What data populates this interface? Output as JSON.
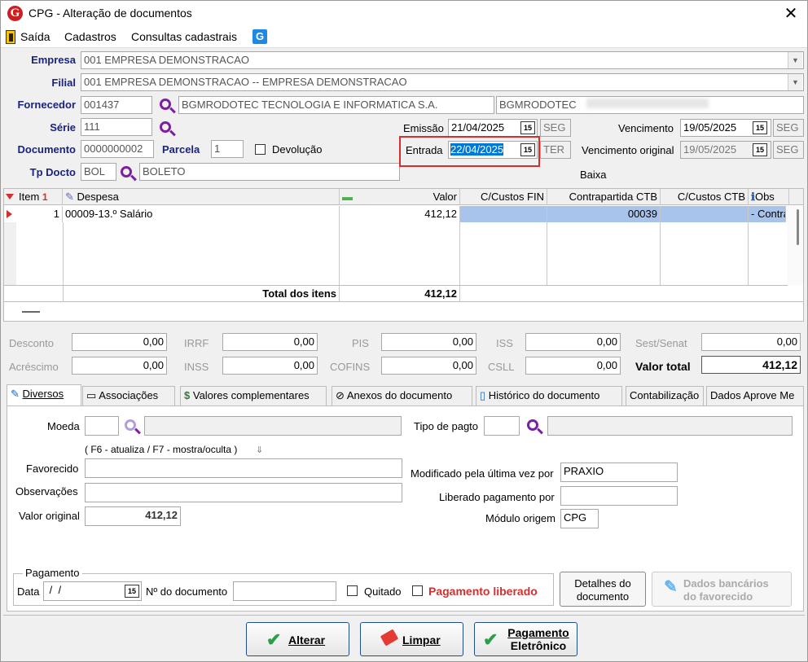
{
  "window": {
    "title": "CPG - Alteração de documentos",
    "logo_letter": "G"
  },
  "menu": {
    "items": [
      "Saída",
      "Cadastros",
      "Consultas cadastrais"
    ]
  },
  "header": {
    "empresa_label": "Empresa",
    "empresa_value": "001 EMPRESA DEMONSTRACAO",
    "filial_label": "Filial",
    "filial_value": "001 EMPRESA DEMONSTRACAO -- EMPRESA DEMONSTRACAO",
    "fornecedor_label": "Fornecedor",
    "fornecedor_code": "001437",
    "fornecedor_name": "BGMRODOTEC TECNOLOGIA E INFORMATICA S.A.",
    "fornecedor_short": "BGMRODOTEC",
    "serie_label": "Série",
    "serie_value": "111",
    "documento_label": "Documento",
    "documento_value": "0000000002",
    "parcela_label": "Parcela",
    "parcela_value": "1",
    "devolucao_label": "Devolução",
    "tpdocto_label": "Tp Docto",
    "tpdocto_code": "BOL",
    "tpdocto_name": "BOLETO",
    "emissao_label": "Emissão",
    "emissao_value": "21/04/2025",
    "emissao_day": "SEG",
    "entrada_label": "Entrada",
    "entrada_value": "22/04/2025",
    "entrada_day": "TER",
    "vencimento_label": "Vencimento",
    "vencimento_value": "19/05/2025",
    "vencimento_day": "SEG",
    "venc_original_label": "Vencimento original",
    "venc_original_value": "19/05/2025",
    "venc_original_day": "SEG",
    "baixa_label": "Baixa",
    "cal_glyph": "15"
  },
  "grid": {
    "columns": [
      "Item",
      "Despesa",
      "Valor",
      "C/Custos FIN",
      "Contrapartida CTB",
      "C/Custos CTB",
      "Obs"
    ],
    "item_sort_glyph": "1",
    "rows": [
      {
        "item": "1",
        "despesa": "00009-13.º Salário",
        "valor": "412,12",
        "ccfin": "",
        "contrapartida": "00039",
        "ccctb": "",
        "obs": "- Contra"
      }
    ],
    "total_label": "Total dos itens",
    "total_value": "412,12"
  },
  "totals": {
    "desconto_label": "Desconto",
    "desconto": "0,00",
    "irrf_label": "IRRF",
    "irrf": "0,00",
    "pis_label": "PIS",
    "pis": "0,00",
    "iss_label": "ISS",
    "iss": "0,00",
    "sest_label": "Sest/Senat",
    "sest": "0,00",
    "acrescimo_label": "Acréscimo",
    "acrescimo": "0,00",
    "inss_label": "INSS",
    "inss": "0,00",
    "cofins_label": "COFINS",
    "cofins": "0,00",
    "csll_label": "CSLL",
    "csll": "0,00",
    "valor_total_label": "Valor total",
    "valor_total": "412,12"
  },
  "tabs": [
    "Diversos",
    "Associações",
    "Valores complementares",
    "Anexos do documento",
    "Histórico do documento",
    "Contabilização",
    "Dados Aprove Me"
  ],
  "diversos": {
    "moeda_label": "Moeda",
    "moeda_value": "",
    "tipo_pagto_label": "Tipo de pagto",
    "tipo_pagto_value": "",
    "hint": "( F6 - atualiza / F7 - mostra/oculta )",
    "favorecido_label": "Favorecido",
    "favorecido_value": "",
    "observacoes_label": "Observações",
    "observacoes_value": "",
    "valor_original_label": "Valor original",
    "valor_original_value": "412,12",
    "modificado_label": "Modificado pela última vez por",
    "modificado_value": "PRAXIO",
    "liberado_label": "Liberado pagamento por",
    "liberado_value": "",
    "modulo_label": "Módulo origem",
    "modulo_value": "CPG"
  },
  "pagamento": {
    "group_label": "Pagamento",
    "data_label": "Data",
    "data_value": " /  /",
    "ndoc_label": "Nº do documento",
    "ndoc_value": "",
    "quitado_label": "Quitado",
    "liberado_label": "Pagamento liberado",
    "detalhes_label_1": "Detalhes do",
    "detalhes_label_2": "documento",
    "bancarios_label_1": "Dados bancários",
    "bancarios_label_2": "do favorecido"
  },
  "footer": {
    "alterar": "Alterar",
    "limpar": "Limpar",
    "pagamento_1": "Pagamento",
    "pagamento_2": "Eletrônico"
  },
  "colors": {
    "accent_red": "#cc1f1f",
    "brand_blue": "#1a237e",
    "selection_blue": "#0078d7",
    "row_highlight": "#a9c4ec",
    "search_purple": "#7b1fa2"
  }
}
